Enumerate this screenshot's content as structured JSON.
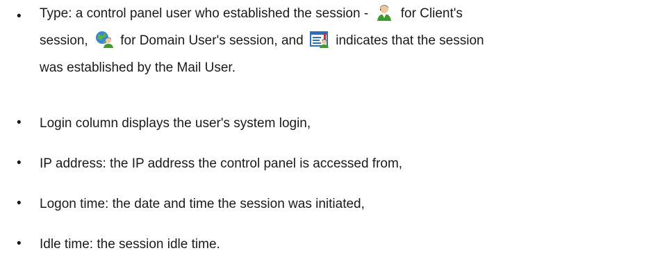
{
  "items": [
    {
      "line1_a": "Type: a control panel user who established the session - ",
      "line1_b": " for Client's",
      "line2_a": "session, ",
      "line2_b": " for Domain User's session, and ",
      "line2_c": " indicates that the session",
      "line3": "was established by the Mail User."
    },
    {
      "text": "Login column displays the user's system login,"
    },
    {
      "text": "IP address: the IP address the control panel is accessed from,"
    },
    {
      "text": "Logon time: the date and time the session was initiated,"
    },
    {
      "text": "Idle time: the session idle time."
    }
  ],
  "bullet": "•",
  "icons": {
    "client": "client-user-icon",
    "domain_user": "domain-user-icon",
    "mail_user": "mail-user-icon"
  }
}
